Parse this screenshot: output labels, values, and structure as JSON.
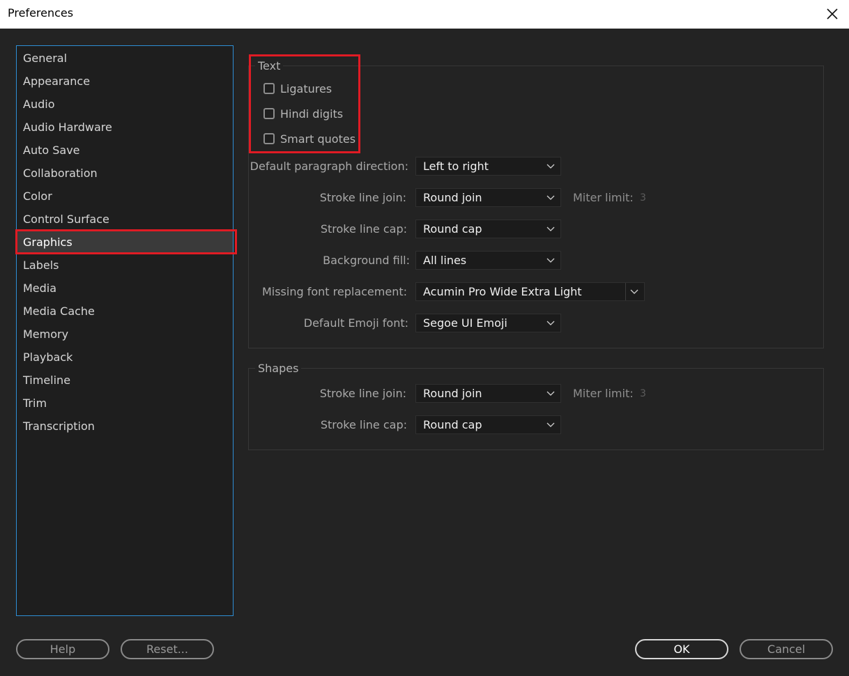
{
  "window": {
    "title": "Preferences",
    "close_icon": "close-icon"
  },
  "colors": {
    "accent": "#2e8fd6",
    "highlight": "#e01b24",
    "background": "#232323"
  },
  "sidebar": {
    "selected": "Graphics",
    "items": [
      {
        "label": "General"
      },
      {
        "label": "Appearance"
      },
      {
        "label": "Audio"
      },
      {
        "label": "Audio Hardware"
      },
      {
        "label": "Auto Save"
      },
      {
        "label": "Collaboration"
      },
      {
        "label": "Color"
      },
      {
        "label": "Control Surface"
      },
      {
        "label": "Graphics"
      },
      {
        "label": "Labels"
      },
      {
        "label": "Media"
      },
      {
        "label": "Media Cache"
      },
      {
        "label": "Memory"
      },
      {
        "label": "Playback"
      },
      {
        "label": "Timeline"
      },
      {
        "label": "Trim"
      },
      {
        "label": "Transcription"
      }
    ]
  },
  "text_group": {
    "legend": "Text",
    "checkboxes": [
      {
        "label": "Ligatures",
        "checked": false
      },
      {
        "label": "Hindi digits",
        "checked": false
      },
      {
        "label": "Smart quotes",
        "checked": false
      }
    ],
    "paragraph_direction": {
      "label": "Default paragraph direction:",
      "value": "Left to right"
    },
    "stroke_line_join": {
      "label": "Stroke line join:",
      "value": "Round join"
    },
    "miter_limit": {
      "label": "Miter limit:",
      "value": "3"
    },
    "stroke_line_cap": {
      "label": "Stroke line cap:",
      "value": "Round cap"
    },
    "background_fill": {
      "label": "Background fill:",
      "value": "All lines"
    },
    "missing_font": {
      "label": "Missing font replacement:",
      "value": "Acumin Pro Wide Extra Light"
    },
    "emoji_font": {
      "label": "Default Emoji font:",
      "value": "Segoe UI Emoji"
    }
  },
  "shapes_group": {
    "legend": "Shapes",
    "stroke_line_join": {
      "label": "Stroke line join:",
      "value": "Round join"
    },
    "miter_limit": {
      "label": "Miter limit:",
      "value": "3"
    },
    "stroke_line_cap": {
      "label": "Stroke line cap:",
      "value": "Round cap"
    }
  },
  "buttons": {
    "help": "Help",
    "reset": "Reset...",
    "ok": "OK",
    "cancel": "Cancel"
  }
}
